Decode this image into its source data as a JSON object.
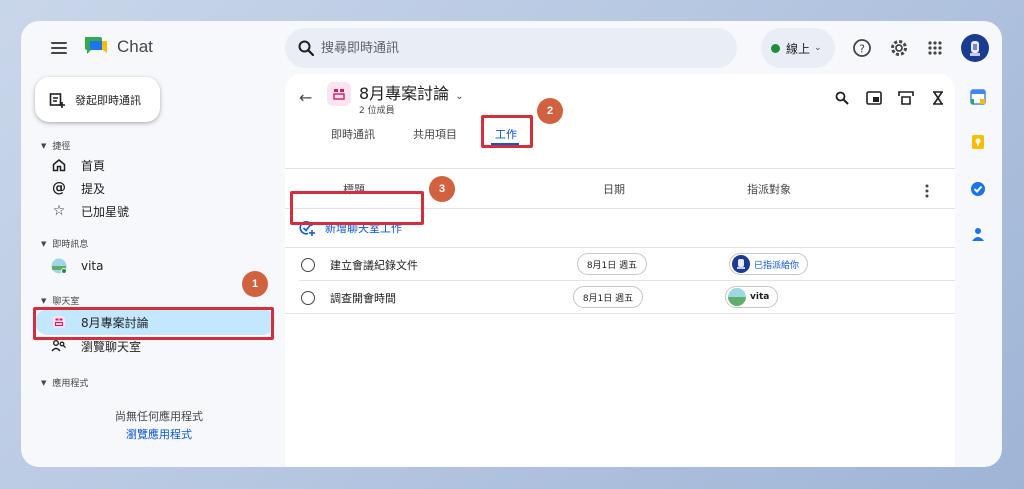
{
  "app": {
    "title": "Chat"
  },
  "search": {
    "placeholder": "搜尋即時通訊"
  },
  "status": {
    "label": "線上"
  },
  "sidebar": {
    "new_chat_label": "發起即時通訊",
    "sections": {
      "shortcuts": "捷徑",
      "direct_messages": "即時訊息",
      "spaces": "聊天室",
      "apps": "應用程式"
    },
    "shortcuts": [
      {
        "label": "首頁",
        "icon": "home-icon"
      },
      {
        "label": "提及",
        "icon": "at-icon"
      },
      {
        "label": "已加星號",
        "icon": "star-icon"
      }
    ],
    "direct_messages": [
      {
        "label": "vita",
        "icon": "user-avatar"
      }
    ],
    "spaces": [
      {
        "label": "8月專案討論",
        "icon": "space-icon",
        "active": true
      },
      {
        "label": "瀏覽聊天室",
        "icon": "browse-spaces-icon"
      }
    ],
    "no_apps_text": "尚無任何應用程式",
    "browse_apps_link": "瀏覽應用程式"
  },
  "room": {
    "title": "8月專案討論",
    "members": "2 位成員",
    "tabs": [
      {
        "label": "即時通訊"
      },
      {
        "label": "共用項目"
      },
      {
        "label": "工作",
        "active": true
      }
    ]
  },
  "tasks": {
    "columns": {
      "title": "標題",
      "date": "日期",
      "assignee": "指派對象"
    },
    "add_task_label": "新增聊天室工作",
    "rows": [
      {
        "title": "建立會議紀錄文件",
        "date": "8月1日 週五",
        "assignee": "已指派給你"
      },
      {
        "title": "調查開會時間",
        "date": "8月1日 週五",
        "assignee": "vita"
      }
    ]
  },
  "annotations": {
    "badge_1": "1",
    "badge_2": "2",
    "badge_3": "3"
  },
  "colors": {
    "accent": "#0b57d0",
    "active_nav": "#c2e7ff",
    "highlight_box": "#d32f3a",
    "badge": "#d0623f",
    "online": "#1e8e3e"
  }
}
